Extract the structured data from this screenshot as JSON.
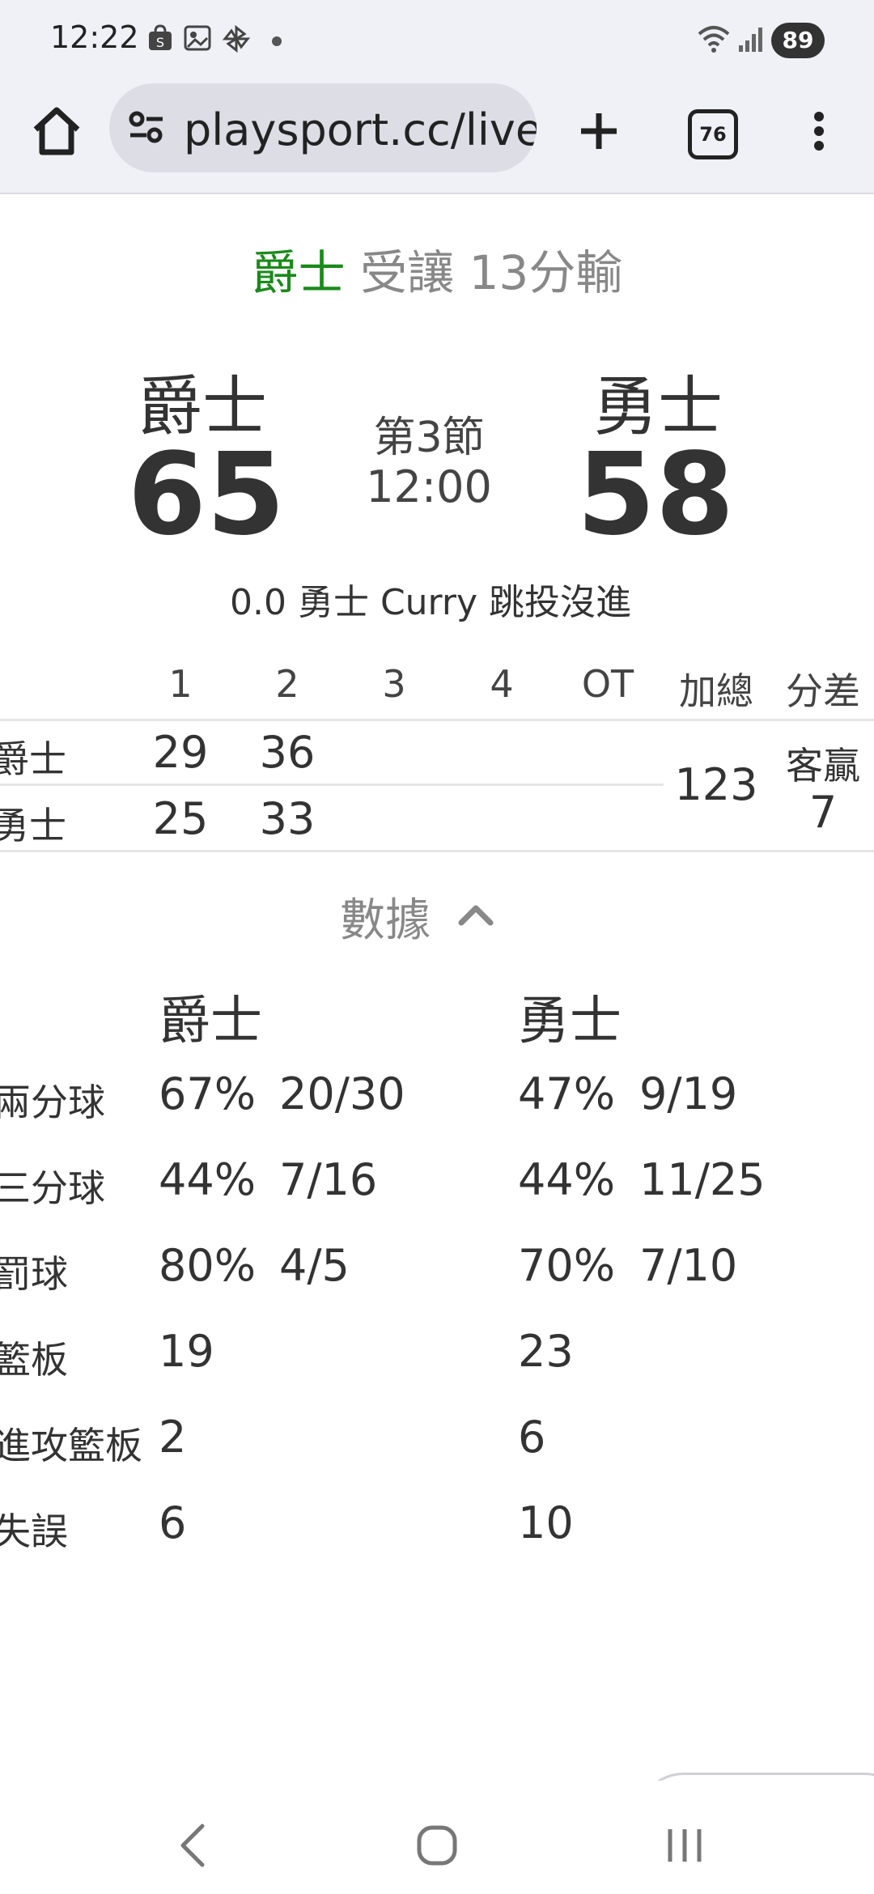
{
  "status_bar": {
    "time": "12:22",
    "battery": "89",
    "icons": [
      "shopping-bag-icon",
      "screenshot-icon",
      "pinwheel-icon",
      "dot-icon",
      "wifi-icon",
      "signal-icon"
    ]
  },
  "browser": {
    "url": "playsport.cc/live",
    "tab_count": "76"
  },
  "game": {
    "handicap_team": "爵士",
    "handicap_text": "受讓 13分輸",
    "away_name": "爵士",
    "away_score": "65",
    "home_name": "勇士",
    "home_score": "58",
    "period": "第3節",
    "clock": "12:00",
    "last_play": "0.0 勇士 Curry 跳投沒進"
  },
  "quarters": {
    "headers": [
      "1",
      "2",
      "3",
      "4",
      "OT",
      "加總",
      "分差"
    ],
    "rows": [
      {
        "team": "爵士",
        "q": [
          "29",
          "36",
          "",
          "",
          ""
        ]
      },
      {
        "team": "勇士",
        "q": [
          "25",
          "33",
          "",
          "",
          ""
        ]
      }
    ],
    "total": "123",
    "diff_label": "客贏",
    "diff_value": "7"
  },
  "stats": {
    "toggle_label": "數據",
    "teams": [
      "爵士",
      "勇士"
    ],
    "rows": [
      {
        "label": "兩分球",
        "a_pct": "67%",
        "a_frac": "20/30",
        "b_pct": "47%",
        "b_frac": "9/19"
      },
      {
        "label": "三分球",
        "a_pct": "44%",
        "a_frac": "7/16",
        "b_pct": "44%",
        "b_frac": "11/25"
      },
      {
        "label": "罰球",
        "a_pct": "80%",
        "a_frac": "4/5",
        "b_pct": "70%",
        "b_frac": "7/10"
      },
      {
        "label": "籃板",
        "a_pct": "19",
        "a_frac": "",
        "b_pct": "23",
        "b_frac": ""
      },
      {
        "label": "進攻籃板",
        "a_pct": "2",
        "a_frac": "",
        "b_pct": "6",
        "b_frac": ""
      },
      {
        "label": "失誤",
        "a_pct": "6",
        "a_frac": "",
        "b_pct": "10",
        "b_frac": ""
      }
    ]
  }
}
